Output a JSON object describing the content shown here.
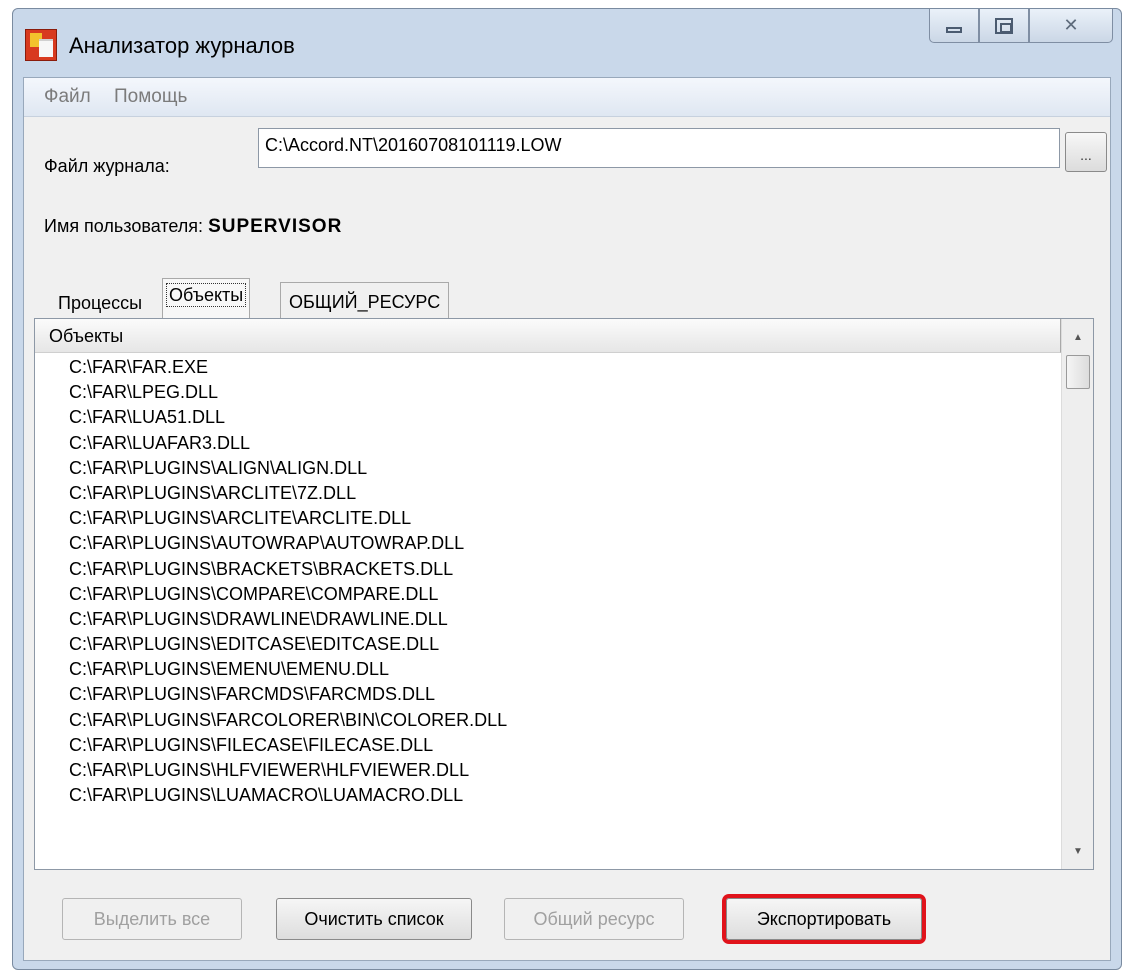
{
  "window": {
    "title": "Анализатор журналов"
  },
  "menu": {
    "items": [
      "Файл",
      "Помощь"
    ]
  },
  "file": {
    "label": "Файл журнала:",
    "value": "C:\\Accord.NT\\20160708101119.LOW",
    "browse_label": "..."
  },
  "user": {
    "label": "Имя пользователя:",
    "value": "SUPERVISOR"
  },
  "tabs": [
    {
      "label": "Процессы",
      "active": false
    },
    {
      "label": "Объекты",
      "active": true
    },
    {
      "label": "ОБЩИЙ_РЕСУРС",
      "active": false
    }
  ],
  "list": {
    "column_header": "Объекты",
    "rows": [
      "C:\\FAR\\FAR.EXE",
      "C:\\FAR\\LPEG.DLL",
      "C:\\FAR\\LUA51.DLL",
      "C:\\FAR\\LUAFAR3.DLL",
      "C:\\FAR\\PLUGINS\\ALIGN\\ALIGN.DLL",
      "C:\\FAR\\PLUGINS\\ARCLITE\\7Z.DLL",
      "C:\\FAR\\PLUGINS\\ARCLITE\\ARCLITE.DLL",
      "C:\\FAR\\PLUGINS\\AUTOWRAP\\AUTOWRAP.DLL",
      "C:\\FAR\\PLUGINS\\BRACKETS\\BRACKETS.DLL",
      "C:\\FAR\\PLUGINS\\COMPARE\\COMPARE.DLL",
      "C:\\FAR\\PLUGINS\\DRAWLINE\\DRAWLINE.DLL",
      "C:\\FAR\\PLUGINS\\EDITCASE\\EDITCASE.DLL",
      "C:\\FAR\\PLUGINS\\EMENU\\EMENU.DLL",
      "C:\\FAR\\PLUGINS\\FARCMDS\\FARCMDS.DLL",
      "C:\\FAR\\PLUGINS\\FARCOLORER\\BIN\\COLORER.DLL",
      "C:\\FAR\\PLUGINS\\FILECASE\\FILECASE.DLL",
      "C:\\FAR\\PLUGINS\\HLFVIEWER\\HLFVIEWER.DLL",
      "C:\\FAR\\PLUGINS\\LUAMACRO\\LUAMACRO.DLL"
    ]
  },
  "buttons": {
    "select_all": "Выделить все",
    "clear_list": "Очистить список",
    "shared_resource": "Общий ресурс",
    "export": "Экспортировать"
  },
  "colors": {
    "highlight": "#e0131b",
    "titlebar": "#c9d8ea"
  }
}
